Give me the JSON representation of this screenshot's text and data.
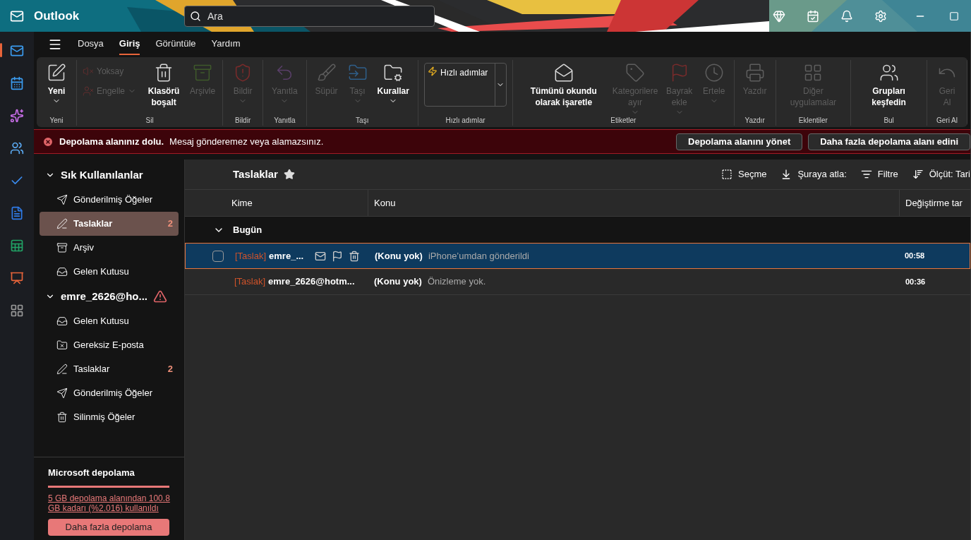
{
  "title_bar": {
    "app_name": "Outlook",
    "search": {
      "placeholder": "Ara"
    }
  },
  "app_rail": [
    {
      "selected": true
    },
    {
      "selected": false
    },
    {
      "selected": false
    },
    {
      "selected": false
    },
    {
      "selected": false
    },
    {
      "selected": false
    },
    {
      "selected": false
    },
    {
      "selected": false
    },
    {
      "selected": false
    }
  ],
  "menu_tabs": [
    {
      "label": "Dosya",
      "selected": false
    },
    {
      "label": "Giriş",
      "selected": true
    },
    {
      "label": "Görüntüle",
      "selected": false
    },
    {
      "label": "Yardım",
      "selected": false
    }
  ],
  "ribbon": [
    {
      "label": "Yeni",
      "items": [
        {
          "kind": "large",
          "label": "Yeni",
          "disabled": false,
          "dropdown": true
        }
      ]
    },
    {
      "label": "Sil",
      "items": [
        {
          "kind": "small",
          "label": "Yoksay",
          "disabled": true,
          "dropdown": false
        },
        {
          "kind": "small",
          "label": "Engelle",
          "disabled": true,
          "dropdown": true
        },
        {
          "kind": "large",
          "label": "Klasörü boşalt",
          "disabled": false,
          "dropdown": false
        },
        {
          "kind": "large",
          "label": "Arşivle",
          "disabled": true,
          "dropdown": false
        }
      ]
    },
    {
      "label": "Bildir",
      "items": [
        {
          "kind": "large",
          "label": "Bildir",
          "disabled": true,
          "dropdown": true
        }
      ]
    },
    {
      "label": "Yanıtla",
      "items": [
        {
          "kind": "large",
          "label": "Yanıtla",
          "disabled": true,
          "dropdown": true
        }
      ]
    },
    {
      "label": "Taşı",
      "items": [
        {
          "kind": "large",
          "label": "Süpür",
          "disabled": true,
          "dropdown": false
        },
        {
          "kind": "large",
          "label": "Taşı",
          "disabled": true,
          "dropdown": true
        },
        {
          "kind": "large",
          "label": "Kurallar",
          "disabled": false,
          "dropdown": true
        }
      ]
    },
    {
      "label": "Hızlı adımlar",
      "items": [
        {
          "kind": "gallery",
          "label": "Hızlı adımlar",
          "disabled": false,
          "dropdown": true
        }
      ]
    },
    {
      "label": "Etiketler",
      "items": [
        {
          "kind": "large",
          "label": "Tümünü okundu olarak işaretle",
          "disabled": false,
          "dropdown": false
        },
        {
          "kind": "large",
          "label": "Kategorilere ayır",
          "disabled": true,
          "dropdown": true
        },
        {
          "kind": "large",
          "label": "Bayrak ekle",
          "disabled": true,
          "dropdown": true
        },
        {
          "kind": "large",
          "label": "Ertele",
          "disabled": true,
          "dropdown": true
        }
      ]
    },
    {
      "label": "Yazdır",
      "items": [
        {
          "kind": "large",
          "label": "Yazdır",
          "disabled": true,
          "dropdown": false
        }
      ]
    },
    {
      "label": "Eklentiler",
      "items": [
        {
          "kind": "large",
          "label": "Diğer uygulamalar",
          "disabled": true,
          "dropdown": false
        }
      ]
    },
    {
      "label": "Bul",
      "items": [
        {
          "kind": "large",
          "label": "Grupları keşfedin",
          "disabled": false,
          "dropdown": false
        }
      ]
    },
    {
      "label": "Geri Al",
      "items": [
        {
          "kind": "large",
          "label": "Geri Al",
          "disabled": true,
          "dropdown": false
        }
      ]
    }
  ],
  "alert": {
    "title": "Depolama alanınız dolu.",
    "message": "Mesaj gönderemez veya alamazsınız.",
    "buttons": [
      "Depolama alanını yönet",
      "Daha fazla depolama alanı edini"
    ]
  },
  "folder_sections": [
    {
      "title": "Sık Kullanılanlar",
      "expanded": true,
      "warning": false,
      "folders": [
        {
          "label": "Gönderilmiş Öğeler",
          "selected": false
        },
        {
          "label": "Taslaklar",
          "selected": true,
          "count": "2"
        },
        {
          "label": "Arşiv",
          "selected": false
        },
        {
          "label": "Gelen Kutusu",
          "selected": false
        }
      ]
    },
    {
      "title": "emre_2626@ho...",
      "expanded": true,
      "warning": true,
      "folders": [
        {
          "label": "Gelen Kutusu",
          "selected": false
        },
        {
          "label": "Gereksiz E-posta",
          "selected": false
        },
        {
          "label": "Taslaklar",
          "selected": false,
          "count": "2"
        },
        {
          "label": "Gönderilmiş Öğeler",
          "selected": false
        },
        {
          "label": "Silinmiş Öğeler",
          "selected": false
        }
      ]
    }
  ],
  "storage": {
    "title": "Microsoft depolama",
    "level": 1,
    "usage_link": "5 GB depolama alanından 100.8 GB kadarı (%2.016) kullanıldı",
    "button": "Daha fazla depolama"
  },
  "message_list": {
    "title": "Taslaklar",
    "favorite": true,
    "toolbar": [
      "Seçme",
      "Şuraya atla:",
      "Filtre",
      "Ölçüt: Tari"
    ],
    "columns": [
      "Kime",
      "Konu",
      "Değiştirme tar"
    ],
    "groups": [
      {
        "label": "Bugün",
        "expanded": true,
        "rows": [
          {
            "tag": "[Taslak]",
            "to": "emre_...",
            "subject": "(Konu yok)",
            "preview": "iPhone’umdan gönderildi",
            "time": "00:58",
            "selected": true,
            "show_actions": true
          },
          {
            "tag": "[Taslak]",
            "to": "emre_2626@hotm...",
            "subject": "(Konu yok)",
            "preview": "Önizleme yok.",
            "time": "00:36",
            "selected": false,
            "show_actions": false
          }
        ]
      }
    ]
  }
}
